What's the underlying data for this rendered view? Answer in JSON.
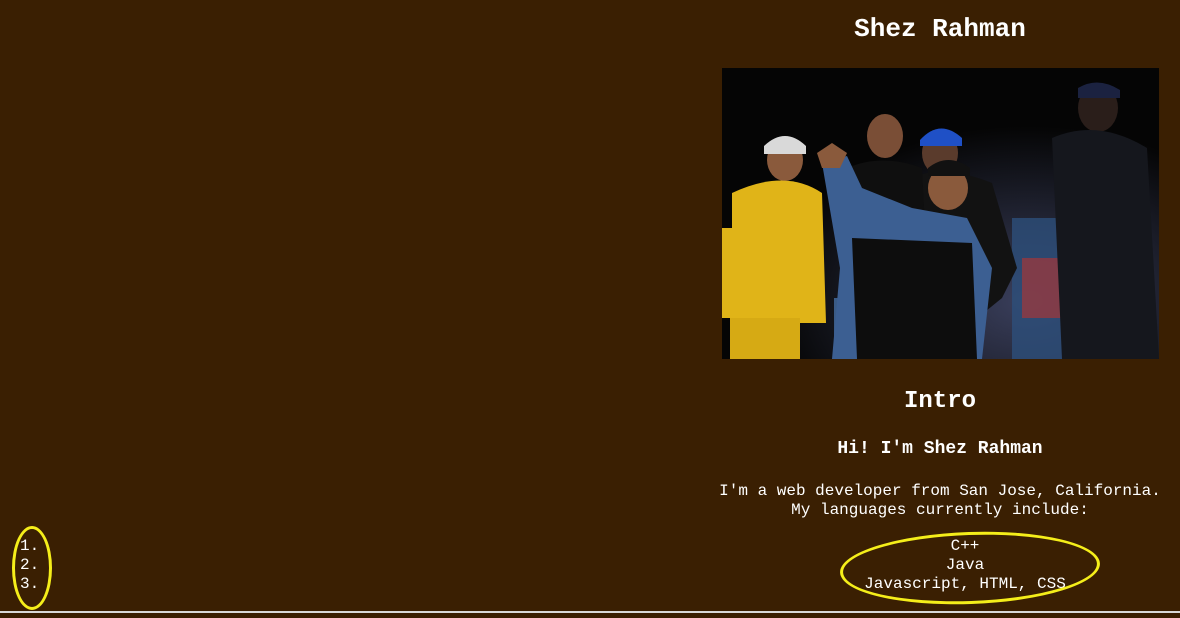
{
  "header": {
    "name": "Shez Rahman"
  },
  "photo": {
    "alt": "Group of five dancers posing on a dark stage"
  },
  "intro": {
    "heading": "Intro",
    "greeting": "Hi! I'm Shez Rahman",
    "bio_line1": "I'm a web developer from San Jose, California.",
    "bio_line2": "My languages currently include:"
  },
  "languages": [
    "C++",
    "Java",
    "Javascript, HTML, CSS"
  ],
  "numbered_list": [
    "1.",
    "2.",
    "3."
  ],
  "colors": {
    "background": "#3a1f02",
    "text": "#ffffff",
    "annotation": "#f5ee1a"
  }
}
